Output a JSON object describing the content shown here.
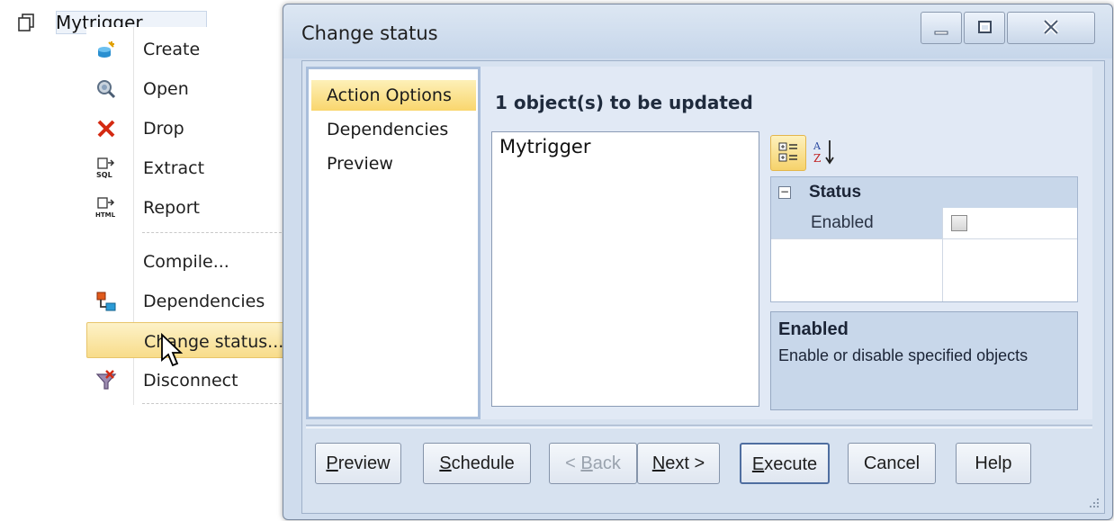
{
  "tree": {
    "node_label": "Mytrigger"
  },
  "context_menu": {
    "items": [
      {
        "label": "Create",
        "icon": "create-icon"
      },
      {
        "label": "Open",
        "icon": "open-icon"
      },
      {
        "label": "Drop",
        "icon": "drop-icon"
      },
      {
        "label": "Extract",
        "icon": "extract-sql-icon",
        "icon_text": "SQL"
      },
      {
        "label": "Report",
        "icon": "report-html-icon",
        "icon_text": "HTML"
      },
      {
        "label": "Compile...",
        "icon": ""
      },
      {
        "label": "Dependencies",
        "icon": "dependencies-icon"
      },
      {
        "label": "Change status...",
        "icon": "",
        "highlighted": true
      },
      {
        "label": "Disconnect",
        "icon": "disconnect-icon"
      }
    ]
  },
  "dialog": {
    "title": "Change status",
    "nav": [
      "Action Options",
      "Dependencies",
      "Preview"
    ],
    "active_nav": "Action Options",
    "heading": "1 object(s) to be updated",
    "objects": [
      "Mytrigger"
    ],
    "properties": {
      "category": "Status",
      "rows": [
        {
          "name": "Enabled",
          "checked": false
        }
      ],
      "description_title": "Enabled",
      "description_text": "Enable or disable specified objects"
    },
    "buttons": {
      "preview": {
        "mnemonic": "P",
        "rest": "review"
      },
      "schedule": {
        "mnemonic": "S",
        "rest": "chedule"
      },
      "back": {
        "prefix": "< ",
        "mnemonic": "B",
        "rest": "ack"
      },
      "next": {
        "mnemonic": "N",
        "rest": "ext >"
      },
      "execute": {
        "mnemonic": "E",
        "rest": "xecute"
      },
      "cancel": "Cancel",
      "help": "Help"
    }
  },
  "colors": {
    "accent_highlight": "#f8dc8a",
    "dialog_bg": "#cfdced",
    "panel_border": "#a9bedb"
  }
}
